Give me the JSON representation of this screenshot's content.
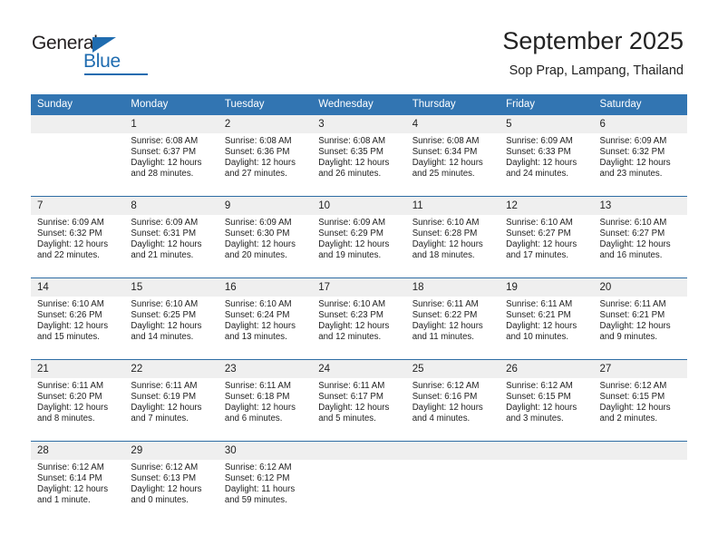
{
  "brand": {
    "name_top": "General",
    "name_bottom": "Blue",
    "accent_color": "#1f6cb0"
  },
  "header": {
    "title": "September 2025",
    "location": "Sop Prap, Lampang, Thailand"
  },
  "theme": {
    "header_bg": "#3275b2",
    "week_divider": "#2e6da4",
    "daynum_bg": "#efefef",
    "text": "#222222"
  },
  "weekday_headers": [
    "Sunday",
    "Monday",
    "Tuesday",
    "Wednesday",
    "Thursday",
    "Friday",
    "Saturday"
  ],
  "weeks": [
    [
      {
        "day": "",
        "sunrise": "",
        "sunset": "",
        "daylight1": "",
        "daylight2": ""
      },
      {
        "day": "1",
        "sunrise": "Sunrise: 6:08 AM",
        "sunset": "Sunset: 6:37 PM",
        "daylight1": "Daylight: 12 hours",
        "daylight2": "and 28 minutes."
      },
      {
        "day": "2",
        "sunrise": "Sunrise: 6:08 AM",
        "sunset": "Sunset: 6:36 PM",
        "daylight1": "Daylight: 12 hours",
        "daylight2": "and 27 minutes."
      },
      {
        "day": "3",
        "sunrise": "Sunrise: 6:08 AM",
        "sunset": "Sunset: 6:35 PM",
        "daylight1": "Daylight: 12 hours",
        "daylight2": "and 26 minutes."
      },
      {
        "day": "4",
        "sunrise": "Sunrise: 6:08 AM",
        "sunset": "Sunset: 6:34 PM",
        "daylight1": "Daylight: 12 hours",
        "daylight2": "and 25 minutes."
      },
      {
        "day": "5",
        "sunrise": "Sunrise: 6:09 AM",
        "sunset": "Sunset: 6:33 PM",
        "daylight1": "Daylight: 12 hours",
        "daylight2": "and 24 minutes."
      },
      {
        "day": "6",
        "sunrise": "Sunrise: 6:09 AM",
        "sunset": "Sunset: 6:32 PM",
        "daylight1": "Daylight: 12 hours",
        "daylight2": "and 23 minutes."
      }
    ],
    [
      {
        "day": "7",
        "sunrise": "Sunrise: 6:09 AM",
        "sunset": "Sunset: 6:32 PM",
        "daylight1": "Daylight: 12 hours",
        "daylight2": "and 22 minutes."
      },
      {
        "day": "8",
        "sunrise": "Sunrise: 6:09 AM",
        "sunset": "Sunset: 6:31 PM",
        "daylight1": "Daylight: 12 hours",
        "daylight2": "and 21 minutes."
      },
      {
        "day": "9",
        "sunrise": "Sunrise: 6:09 AM",
        "sunset": "Sunset: 6:30 PM",
        "daylight1": "Daylight: 12 hours",
        "daylight2": "and 20 minutes."
      },
      {
        "day": "10",
        "sunrise": "Sunrise: 6:09 AM",
        "sunset": "Sunset: 6:29 PM",
        "daylight1": "Daylight: 12 hours",
        "daylight2": "and 19 minutes."
      },
      {
        "day": "11",
        "sunrise": "Sunrise: 6:10 AM",
        "sunset": "Sunset: 6:28 PM",
        "daylight1": "Daylight: 12 hours",
        "daylight2": "and 18 minutes."
      },
      {
        "day": "12",
        "sunrise": "Sunrise: 6:10 AM",
        "sunset": "Sunset: 6:27 PM",
        "daylight1": "Daylight: 12 hours",
        "daylight2": "and 17 minutes."
      },
      {
        "day": "13",
        "sunrise": "Sunrise: 6:10 AM",
        "sunset": "Sunset: 6:27 PM",
        "daylight1": "Daylight: 12 hours",
        "daylight2": "and 16 minutes."
      }
    ],
    [
      {
        "day": "14",
        "sunrise": "Sunrise: 6:10 AM",
        "sunset": "Sunset: 6:26 PM",
        "daylight1": "Daylight: 12 hours",
        "daylight2": "and 15 minutes."
      },
      {
        "day": "15",
        "sunrise": "Sunrise: 6:10 AM",
        "sunset": "Sunset: 6:25 PM",
        "daylight1": "Daylight: 12 hours",
        "daylight2": "and 14 minutes."
      },
      {
        "day": "16",
        "sunrise": "Sunrise: 6:10 AM",
        "sunset": "Sunset: 6:24 PM",
        "daylight1": "Daylight: 12 hours",
        "daylight2": "and 13 minutes."
      },
      {
        "day": "17",
        "sunrise": "Sunrise: 6:10 AM",
        "sunset": "Sunset: 6:23 PM",
        "daylight1": "Daylight: 12 hours",
        "daylight2": "and 12 minutes."
      },
      {
        "day": "18",
        "sunrise": "Sunrise: 6:11 AM",
        "sunset": "Sunset: 6:22 PM",
        "daylight1": "Daylight: 12 hours",
        "daylight2": "and 11 minutes."
      },
      {
        "day": "19",
        "sunrise": "Sunrise: 6:11 AM",
        "sunset": "Sunset: 6:21 PM",
        "daylight1": "Daylight: 12 hours",
        "daylight2": "and 10 minutes."
      },
      {
        "day": "20",
        "sunrise": "Sunrise: 6:11 AM",
        "sunset": "Sunset: 6:21 PM",
        "daylight1": "Daylight: 12 hours",
        "daylight2": "and 9 minutes."
      }
    ],
    [
      {
        "day": "21",
        "sunrise": "Sunrise: 6:11 AM",
        "sunset": "Sunset: 6:20 PM",
        "daylight1": "Daylight: 12 hours",
        "daylight2": "and 8 minutes."
      },
      {
        "day": "22",
        "sunrise": "Sunrise: 6:11 AM",
        "sunset": "Sunset: 6:19 PM",
        "daylight1": "Daylight: 12 hours",
        "daylight2": "and 7 minutes."
      },
      {
        "day": "23",
        "sunrise": "Sunrise: 6:11 AM",
        "sunset": "Sunset: 6:18 PM",
        "daylight1": "Daylight: 12 hours",
        "daylight2": "and 6 minutes."
      },
      {
        "day": "24",
        "sunrise": "Sunrise: 6:11 AM",
        "sunset": "Sunset: 6:17 PM",
        "daylight1": "Daylight: 12 hours",
        "daylight2": "and 5 minutes."
      },
      {
        "day": "25",
        "sunrise": "Sunrise: 6:12 AM",
        "sunset": "Sunset: 6:16 PM",
        "daylight1": "Daylight: 12 hours",
        "daylight2": "and 4 minutes."
      },
      {
        "day": "26",
        "sunrise": "Sunrise: 6:12 AM",
        "sunset": "Sunset: 6:15 PM",
        "daylight1": "Daylight: 12 hours",
        "daylight2": "and 3 minutes."
      },
      {
        "day": "27",
        "sunrise": "Sunrise: 6:12 AM",
        "sunset": "Sunset: 6:15 PM",
        "daylight1": "Daylight: 12 hours",
        "daylight2": "and 2 minutes."
      }
    ],
    [
      {
        "day": "28",
        "sunrise": "Sunrise: 6:12 AM",
        "sunset": "Sunset: 6:14 PM",
        "daylight1": "Daylight: 12 hours",
        "daylight2": "and 1 minute."
      },
      {
        "day": "29",
        "sunrise": "Sunrise: 6:12 AM",
        "sunset": "Sunset: 6:13 PM",
        "daylight1": "Daylight: 12 hours",
        "daylight2": "and 0 minutes."
      },
      {
        "day": "30",
        "sunrise": "Sunrise: 6:12 AM",
        "sunset": "Sunset: 6:12 PM",
        "daylight1": "Daylight: 11 hours",
        "daylight2": "and 59 minutes."
      },
      {
        "day": "",
        "sunrise": "",
        "sunset": "",
        "daylight1": "",
        "daylight2": ""
      },
      {
        "day": "",
        "sunrise": "",
        "sunset": "",
        "daylight1": "",
        "daylight2": ""
      },
      {
        "day": "",
        "sunrise": "",
        "sunset": "",
        "daylight1": "",
        "daylight2": ""
      },
      {
        "day": "",
        "sunrise": "",
        "sunset": "",
        "daylight1": "",
        "daylight2": ""
      }
    ]
  ]
}
